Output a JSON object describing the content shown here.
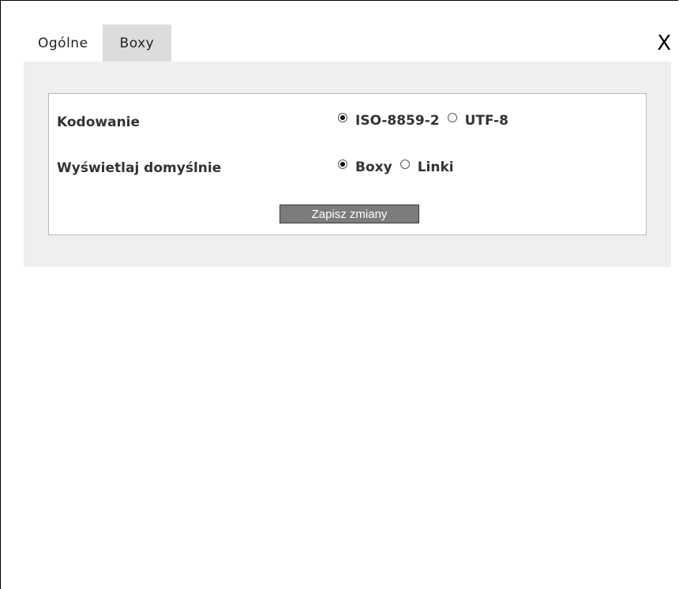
{
  "dialog": {
    "close_label": "X"
  },
  "tabs": [
    {
      "label": "Ogólne",
      "active": true
    },
    {
      "label": "Boxy",
      "active": false
    }
  ],
  "settings": {
    "encoding": {
      "label": "Kodowanie",
      "options": [
        {
          "label": "ISO-8859-2",
          "selected": true
        },
        {
          "label": "UTF-8",
          "selected": false
        }
      ]
    },
    "display": {
      "label": "Wyświetlaj domyślnie",
      "options": [
        {
          "label": "Boxy",
          "selected": true
        },
        {
          "label": "Linki",
          "selected": false
        }
      ]
    },
    "save_label": "Zapisz zmiany"
  },
  "colors": {
    "panel_bg": "#efefef",
    "inactive_tab_bg": "#dcdcdc",
    "button_bg": "#7c7c7c"
  }
}
